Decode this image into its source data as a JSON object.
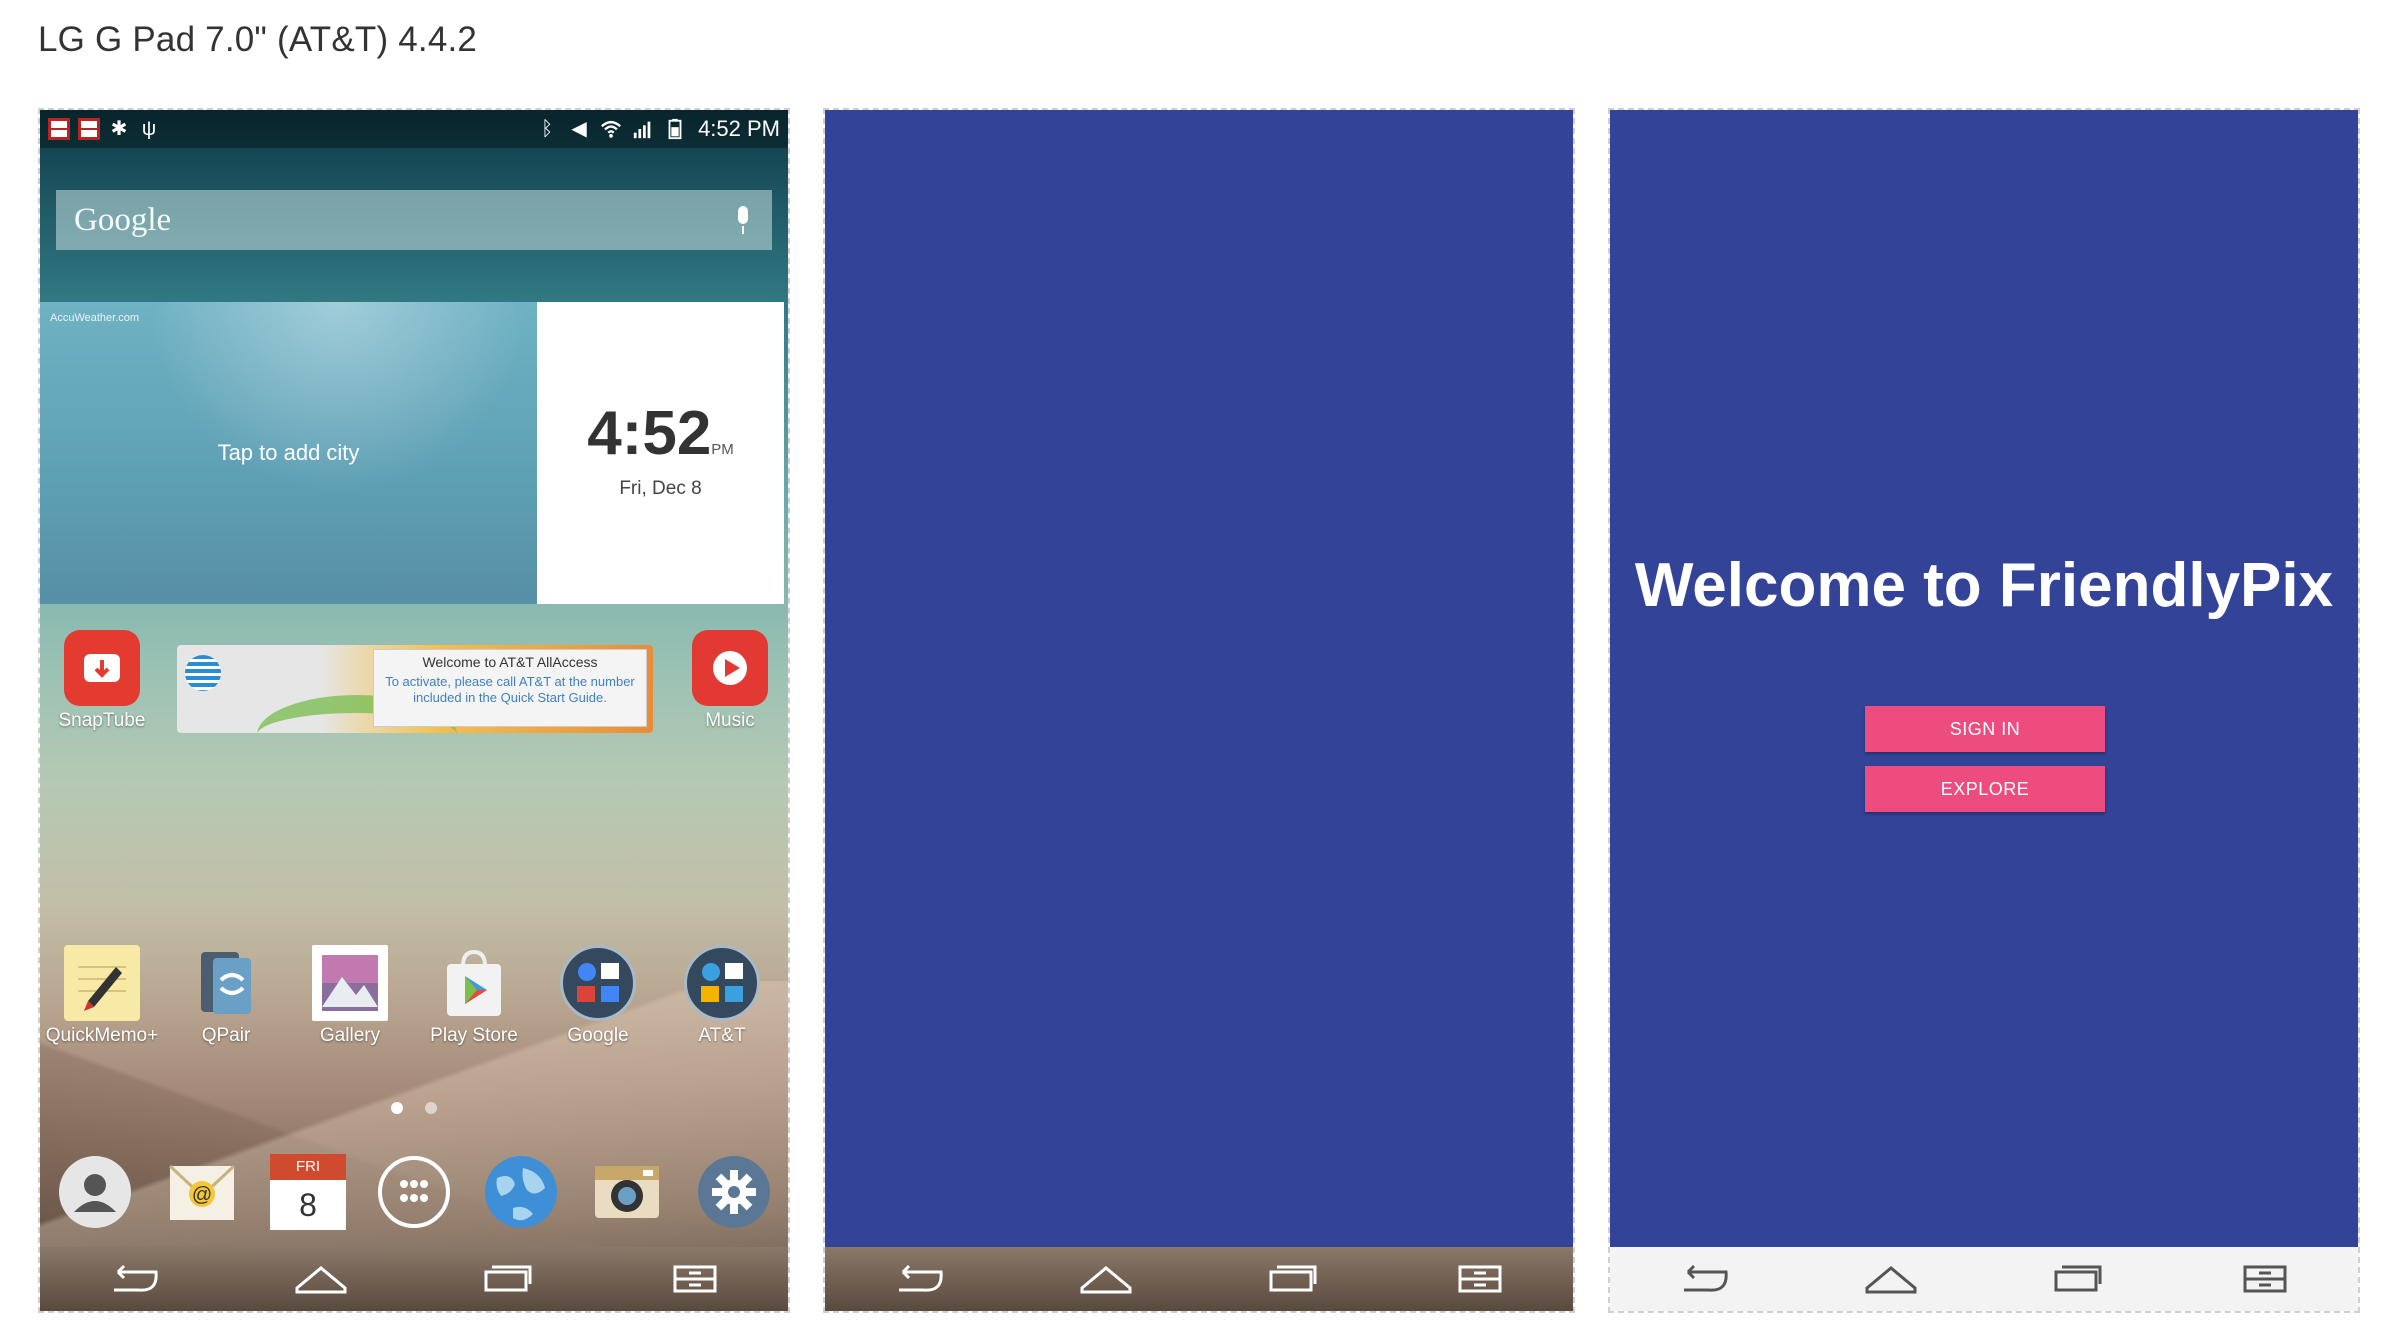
{
  "page": {
    "title": "LG G Pad 7.0\" (AT&T) 4.4.2"
  },
  "home": {
    "status_time": "4:52 PM",
    "search_logo": "Google",
    "weather": {
      "brand": "AccuWeather.com",
      "prompt": "Tap to add city"
    },
    "clock": {
      "time": "4:52",
      "ampm": "PM",
      "date": "Fri, Dec 8"
    },
    "apps_top": {
      "snaptube": "SnapTube",
      "music": "Music"
    },
    "att_popup": {
      "title": "Welcome to AT&T AllAccess",
      "body": "To activate, please call AT&T at the number included in the Quick Start Guide."
    },
    "apps_row": [
      "QuickMemo+",
      "QPair",
      "Gallery",
      "Play Store",
      "Google",
      "AT&T"
    ],
    "calendar": {
      "day": "FRI",
      "date": "8"
    }
  },
  "welcome": {
    "title": "Welcome to FriendlyPix",
    "sign_in": "SIGN IN",
    "explore": "EXPLORE"
  },
  "colors": {
    "primary": "#334398",
    "accent": "#ec4c7e"
  }
}
